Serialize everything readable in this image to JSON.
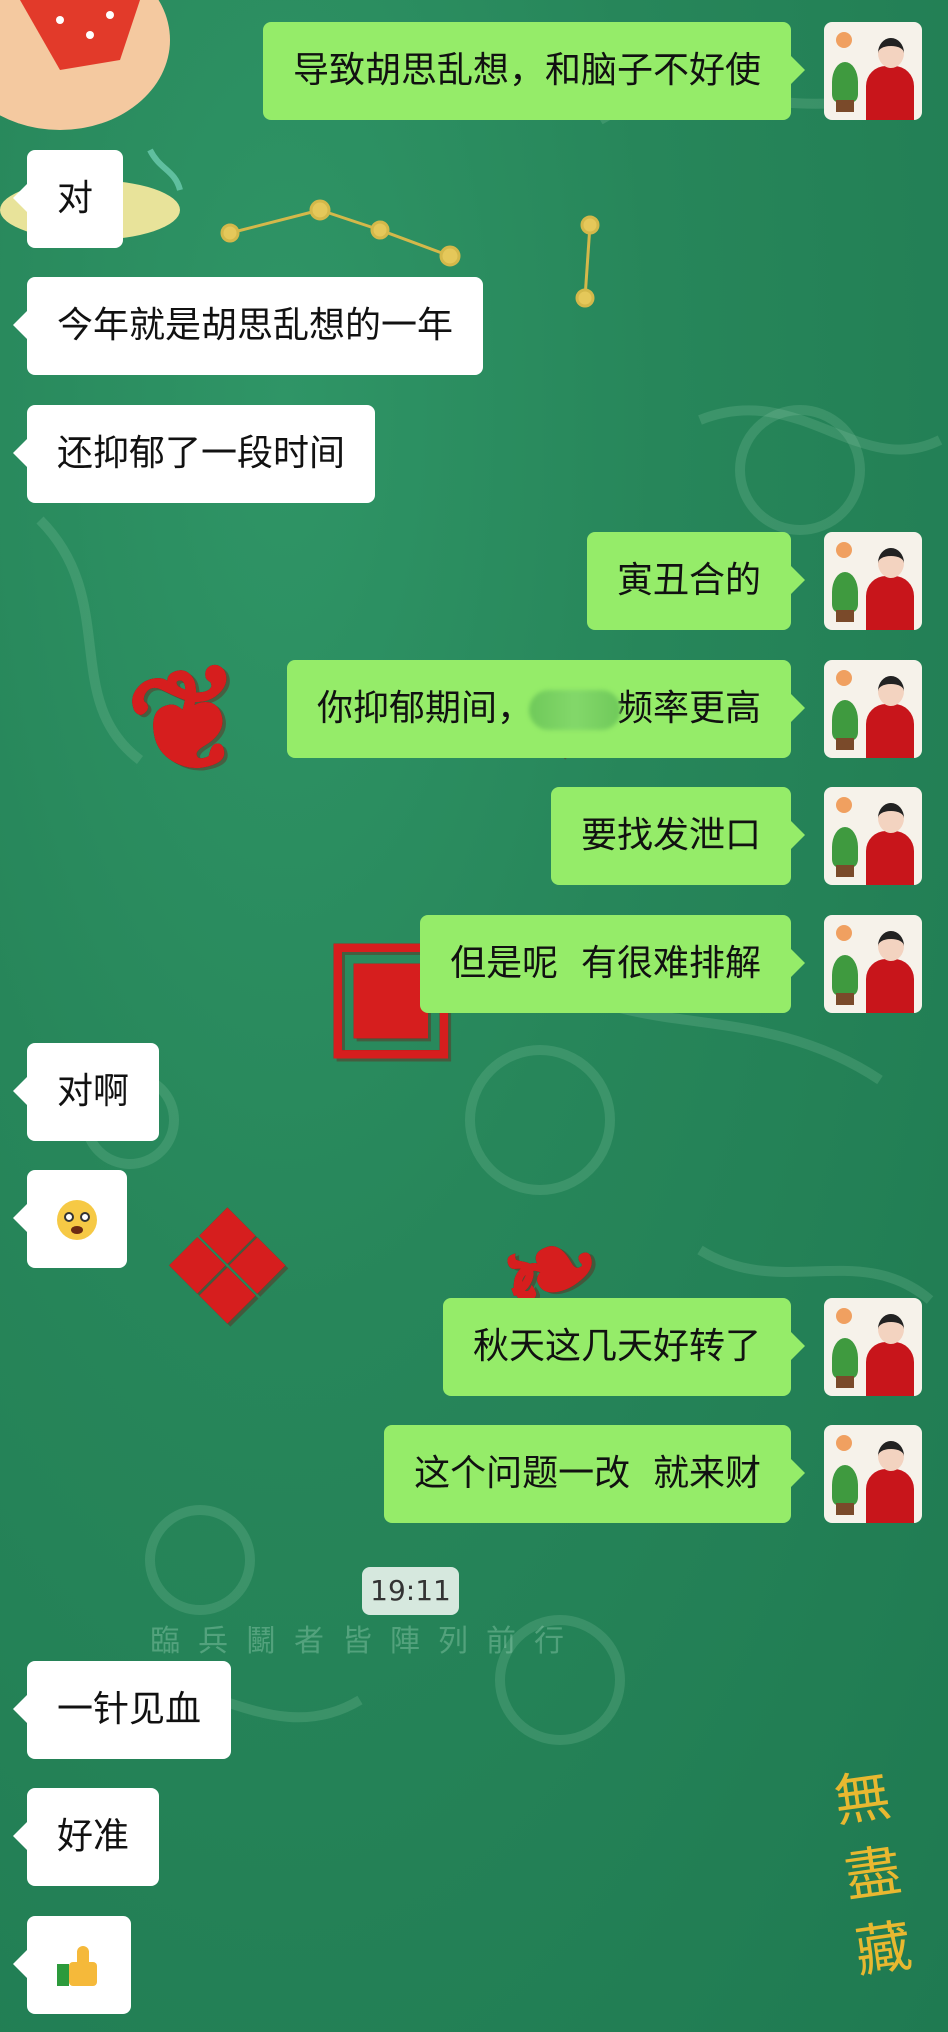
{
  "chat": {
    "messages": [
      {
        "dir": "out",
        "text": "导致胡思乱想，和脑子不好使"
      },
      {
        "dir": "in",
        "text": "对"
      },
      {
        "dir": "in",
        "text": "今年就是胡思乱想的一年"
      },
      {
        "dir": "in",
        "text": "还抑郁了一段时间"
      },
      {
        "dir": "out",
        "text": "寅丑合的"
      },
      {
        "dir": "out",
        "text_before": "你抑郁期间，",
        "text_after": "频率更高",
        "redacted": true
      },
      {
        "dir": "out",
        "text": "要找发泄口"
      },
      {
        "dir": "out",
        "text": "但是呢  有很难排解"
      },
      {
        "dir": "in",
        "text": "对啊"
      },
      {
        "dir": "in",
        "emoji": "crying-face-emoji"
      },
      {
        "dir": "out",
        "text": "秋天这几天好转了"
      },
      {
        "dir": "out",
        "text": "这个问题一改  就来财"
      },
      {
        "dir": "in",
        "text": "一针见血"
      },
      {
        "dir": "in",
        "text": "好准"
      },
      {
        "dir": "in",
        "emoji": "thumbs-up-emoji"
      }
    ],
    "timestamp": "19:11"
  },
  "background": {
    "caption": "臨兵鬭者皆陣列前行",
    "seal_text": "無盡藏",
    "colors": {
      "base": "#27865a",
      "red": "#d61e1e",
      "gold": "#e8b830"
    }
  },
  "colors": {
    "outgoing_bubble": "#95ec69",
    "incoming_bubble": "#ffffff"
  }
}
